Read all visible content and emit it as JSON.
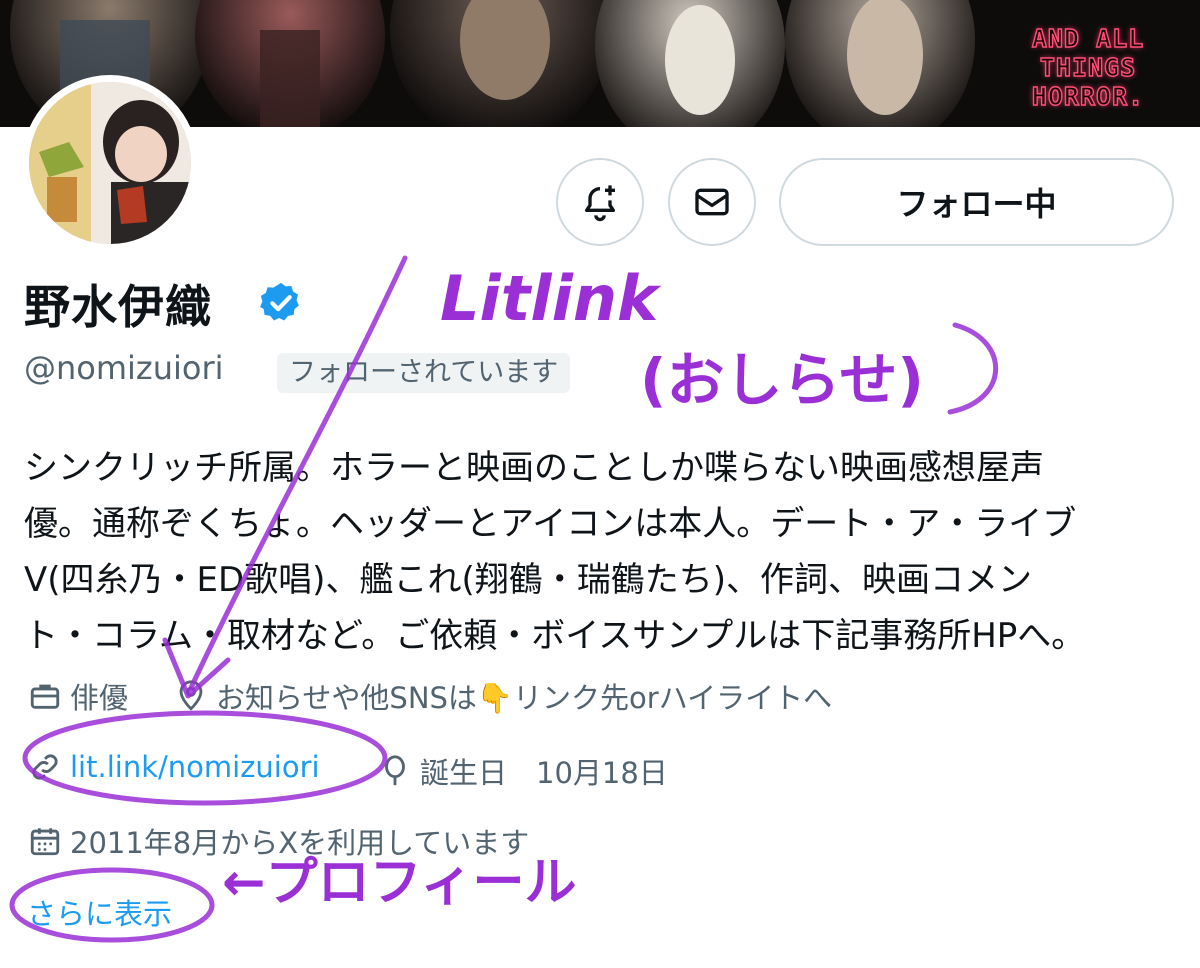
{
  "header": {
    "banner_text": [
      "AND ALL",
      "THINGS",
      "HORROR."
    ]
  },
  "actions": {
    "follow_label": "フォロー中"
  },
  "profile": {
    "display_name": "野水伊織",
    "handle": "@nomizuiori",
    "follows_you": "フォローされています",
    "bio_lines": [
      "シンクリッチ所属。ホラーと映画のことしか喋らない映画感想屋声",
      "優。通称ぞくちょ。ヘッダーとアイコンは本人。デート・ア・ライブ",
      "Ⅴ(四糸乃・ED歌唱)、艦これ(翔鶴・瑞鶴たち)、作詞、映画コメン",
      "ト・コラム・取材など。ご依頼・ボイスサンプルは下記事務所HPへ。"
    ],
    "profession": "俳優",
    "location": "お知らせや他SNSは👇リンク先orハイライトへ",
    "website": "lit.link/nomizuiori",
    "birthday": "誕生日　10月18日",
    "joined": "2011年8月からXを利用しています",
    "show_more": "さらに表示"
  },
  "annotations": {
    "litlink": "Litlink",
    "oshirase": "(おしらせ)",
    "profile_arrow": "←プロフィール"
  },
  "colors": {
    "accent": "#1d9bf0",
    "secondary_text": "#536471",
    "annotation": "#9a2fd6",
    "banner_neon": "#ff4f78"
  }
}
